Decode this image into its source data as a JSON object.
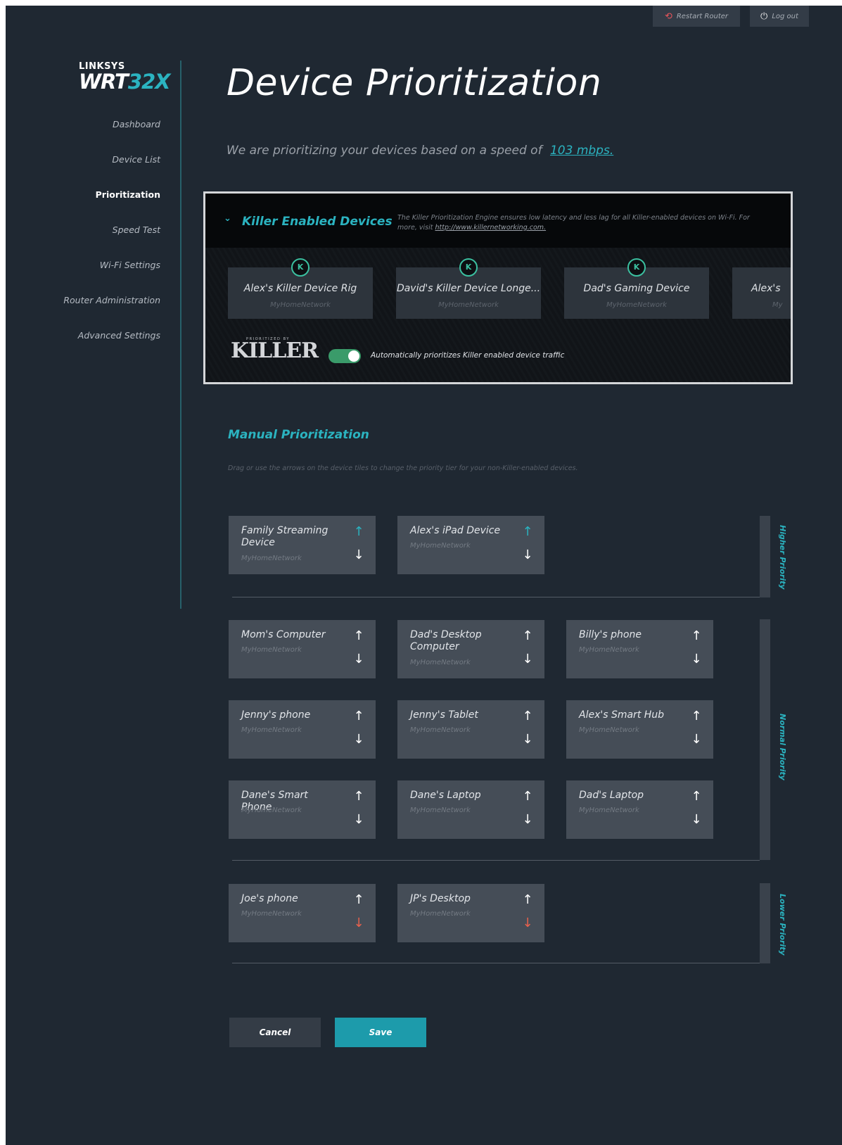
{
  "top_bar": {
    "restart_label": "Restart Router",
    "logout_label": "Log out"
  },
  "logo": {
    "brand": "LINKSYS",
    "model_main": "WRT",
    "model_accent": "32X"
  },
  "sidebar": {
    "items": [
      {
        "label": "Dashboard"
      },
      {
        "label": "Device List"
      },
      {
        "label": "Prioritization"
      },
      {
        "label": "Speed Test"
      },
      {
        "label": "Wi-Fi Settings"
      },
      {
        "label": "Router Administration"
      },
      {
        "label": "Advanced Settings"
      }
    ],
    "active_index": 2
  },
  "page": {
    "title": "Device Prioritization",
    "subtitle_prefix": "We are prioritizing your devices based on a speed of",
    "speed_link": "103 mbps."
  },
  "killer": {
    "title": "Killer Enabled Devices",
    "description": "The Killer Prioritization Engine ensures low latency and less lag for all Killer-enabled devices on Wi-Fi. For more, visit",
    "link": "http://www.killernetworking.com.",
    "devices": [
      {
        "name": "Alex's Killer Device Rig",
        "network": "MyHomeNetwork"
      },
      {
        "name": "David's Killer Device Longe...",
        "network": "MyHomeNetwork"
      },
      {
        "name": "Dad's Gaming Device",
        "network": "MyHomeNetwork"
      },
      {
        "name": "Alex's",
        "network": "My"
      }
    ],
    "logo_prefix": "PRIORITIZED BY",
    "logo_word": "KILLER",
    "toggle_on": true,
    "toggle_label": "Automatically prioritizes Killer enabled device traffic"
  },
  "manual": {
    "title": "Manual Prioritization",
    "description": "Drag or use the arrows on the device tiles to change the priority tier for your non-Killer-enabled devices.",
    "tiers": [
      {
        "label": "Higher Priority",
        "devices": [
          {
            "name": "Family Streaming Device",
            "network": "MyHomeNetwork"
          },
          {
            "name": "Alex's iPad Device",
            "network": "MyHomeNetwork"
          }
        ]
      },
      {
        "label": "Normal Priority",
        "devices": [
          {
            "name": "Mom's Computer",
            "network": "MyHomeNetwork"
          },
          {
            "name": "Dad's Desktop Computer",
            "network": "MyHomeNetwork"
          },
          {
            "name": "Billy's phone",
            "network": "MyHomeNetwork"
          },
          {
            "name": "Jenny's phone",
            "network": "MyHomeNetwork"
          },
          {
            "name": "Jenny's Tablet",
            "network": "MyHomeNetwork"
          },
          {
            "name": "Alex's Smart Hub",
            "network": "MyHomeNetwork"
          },
          {
            "name": "Dane's Smart Phone",
            "network": "MyHomeNetwork"
          },
          {
            "name": "Dane's Laptop",
            "network": "MyHomeNetwork"
          },
          {
            "name": "Dad's Laptop",
            "network": "MyHomeNetwork"
          }
        ]
      },
      {
        "label": "Lower Priority",
        "devices": [
          {
            "name": "Joe's phone",
            "network": "MyHomeNetwork"
          },
          {
            "name": "JP's Desktop",
            "network": "MyHomeNetwork"
          }
        ]
      }
    ]
  },
  "actions": {
    "cancel_label": "Cancel",
    "save_label": "Save"
  },
  "icons": {
    "restart": "restart-icon",
    "logout": "power-icon",
    "collapse": "chevron-down-icon",
    "killer_badge": "killer-k-icon",
    "arrow_up": "arrow-up-icon",
    "arrow_down": "arrow-down-icon"
  },
  "colors": {
    "background": "#1f2832",
    "accent": "#2bb3c0",
    "tile": "#454d57",
    "toggle_on": "#3a9b6a",
    "down_arrow_lower": "#e8614d"
  }
}
